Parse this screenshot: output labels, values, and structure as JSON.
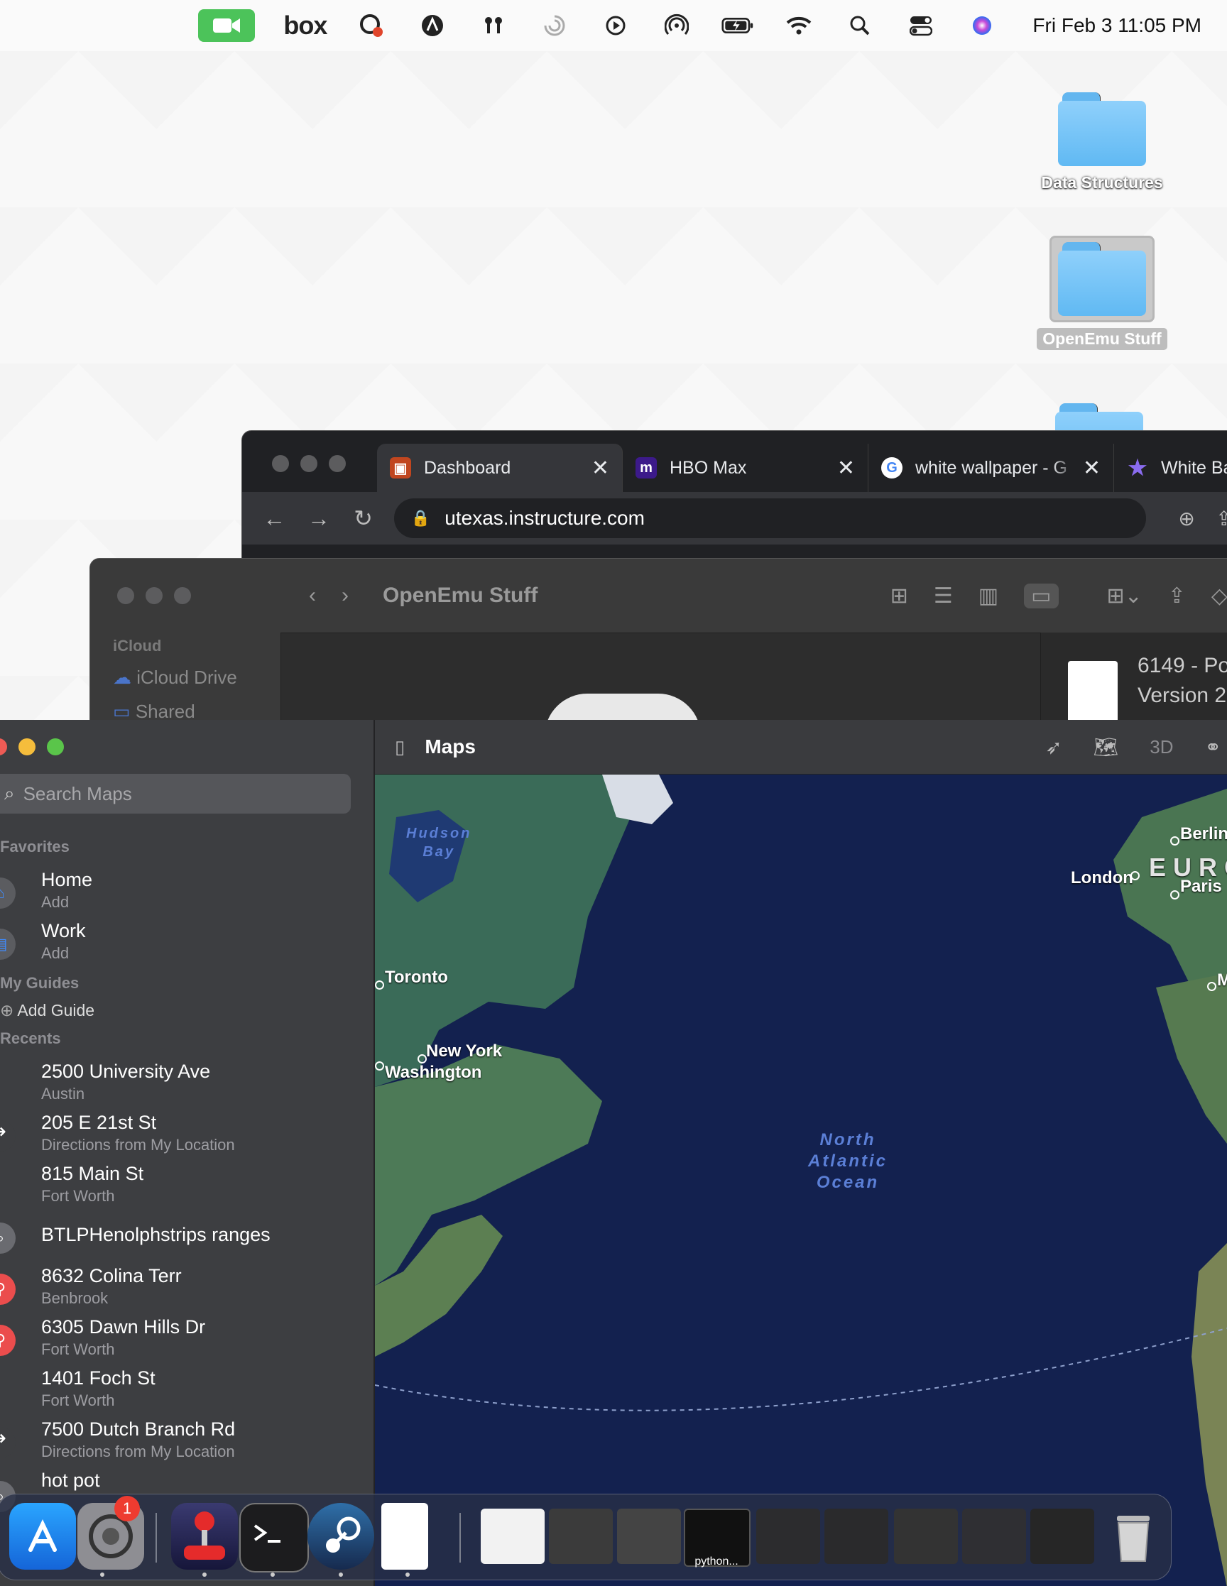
{
  "menubar": {
    "box_label": "box",
    "clock": "Fri Feb 3  11:05 PM"
  },
  "desktop": {
    "items": [
      {
        "label": "Data Structures"
      },
      {
        "label": "OpenEmu Stuff"
      }
    ]
  },
  "chrome": {
    "tabs": [
      {
        "title": "Dashboard",
        "active": true
      },
      {
        "title": "HBO Max",
        "active": false
      },
      {
        "title": "white wallpaper - G",
        "active": false
      },
      {
        "title": "White Ba",
        "active": false
      }
    ],
    "url": "utexas.instructure.com"
  },
  "finder": {
    "title": "OpenEmu Stuff",
    "sidebar_section": "iCloud",
    "sidebar_item": "iCloud Drive",
    "sidebar_item_2": "Shared",
    "preview_line1": "6149 - Po",
    "preview_line2": "Version 2"
  },
  "maps": {
    "title": "Maps",
    "search_placeholder": "Search Maps",
    "toolbar_3d": "3D",
    "favorites_heading": "Favorites",
    "favorites": [
      {
        "title": "Home",
        "subtitle": "Add"
      },
      {
        "title": "Work",
        "subtitle": "Add"
      }
    ],
    "guides_heading": "My Guides",
    "add_guide": "Add Guide",
    "recents_heading": "Recents",
    "recents": [
      {
        "title": "2500 University Ave",
        "subtitle": "Austin",
        "icon": "none"
      },
      {
        "title": "205 E 21st St",
        "subtitle": "Directions from My Location",
        "icon": "directions-icon"
      },
      {
        "title": "815 Main St",
        "subtitle": "Fort Worth",
        "icon": "none"
      },
      {
        "title": "BTLPHenolphstrips ranges",
        "subtitle": "",
        "icon": "search-icon"
      },
      {
        "title": "8632 Colina Terr",
        "subtitle": "Benbrook",
        "icon": "pin-icon"
      },
      {
        "title": "6305 Dawn Hills Dr",
        "subtitle": "Fort Worth",
        "icon": "pin-icon"
      },
      {
        "title": "1401 Foch St",
        "subtitle": "Fort Worth",
        "icon": "none"
      },
      {
        "title": "7500 Dutch Branch Rd",
        "subtitle": "Directions from My Location",
        "icon": "directions-icon"
      },
      {
        "title": "hot pot",
        "subtitle": "",
        "icon": "search-icon"
      }
    ],
    "map_labels": {
      "hudson_bay": "Hudson\nBay",
      "toronto": "Toronto",
      "new_york": "New York",
      "washington": "Washington",
      "london": "London",
      "paris": "Paris",
      "berlin": "Berlin",
      "europe": "EURO",
      "m": "M",
      "ocean": "North\nAtlantic\nOcean"
    }
  },
  "dock": {
    "settings_badge": "1",
    "python_label": "python..."
  }
}
